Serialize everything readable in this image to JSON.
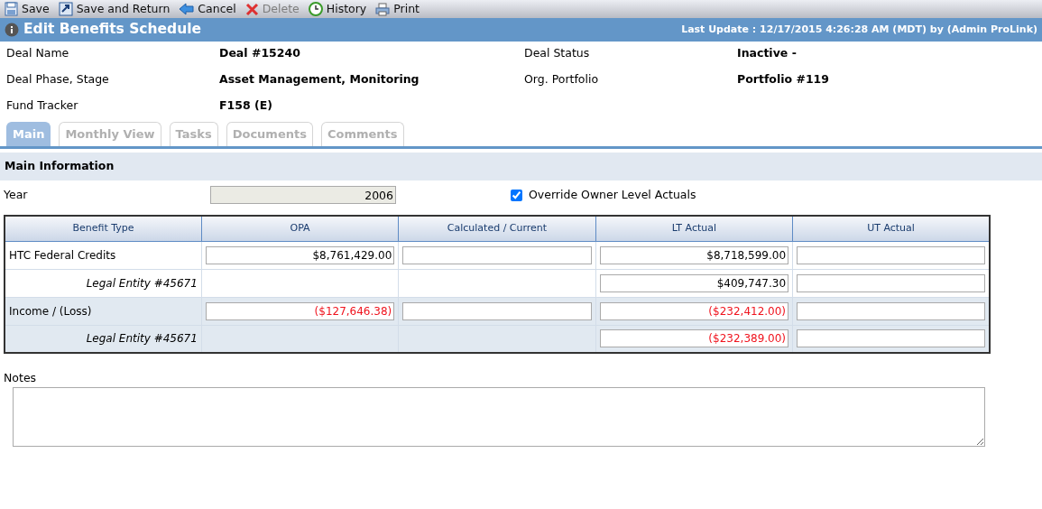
{
  "toolbar": [
    {
      "kind": "save",
      "label": "Save",
      "disabled": false
    },
    {
      "kind": "return",
      "label": "Save and Return",
      "disabled": false
    },
    {
      "kind": "cancel",
      "label": "Cancel",
      "disabled": false
    },
    {
      "kind": "delete",
      "label": "Delete",
      "disabled": true
    },
    {
      "kind": "history",
      "label": "History",
      "disabled": false
    },
    {
      "kind": "print",
      "label": "Print",
      "disabled": false
    }
  ],
  "header": {
    "title": "Edit Benefits Schedule",
    "last_update": "Last Update : 12/17/2015 4:26:28 AM (MDT) by (Admin ProLink)"
  },
  "info": [
    {
      "label": "Deal Name",
      "value": "Deal #15240"
    },
    {
      "label": "Deal Status",
      "value": "Inactive -"
    },
    {
      "label": "Deal Phase, Stage",
      "value": "Asset Management, Monitoring"
    },
    {
      "label": "Org. Portfolio",
      "value": "Portfolio #119"
    },
    {
      "label": "Fund Tracker",
      "value": "F158 (E)"
    }
  ],
  "tabs": [
    {
      "label": "Main",
      "selected": true
    },
    {
      "label": "Monthly View",
      "selected": false
    },
    {
      "label": "Tasks",
      "selected": false
    },
    {
      "label": "Documents",
      "selected": false
    },
    {
      "label": "Comments",
      "selected": false
    }
  ],
  "section_title": "Main Information",
  "year": {
    "label": "Year",
    "value": "2006"
  },
  "override": {
    "label": "Override Owner Level Actuals",
    "checked": true
  },
  "table": {
    "columns": [
      "Benefit Type",
      "OPA",
      "Calculated / Current",
      "LT Actual",
      "UT Actual"
    ],
    "rows": [
      {
        "kind": "main",
        "name": "HTC Federal Credits",
        "shaded": false,
        "cells": [
          {
            "kind": "input",
            "value": "$8,761,429.00",
            "negative": false
          },
          {
            "kind": "input"
          },
          {
            "kind": "input",
            "value": "$8,718,599.00",
            "negative": false
          },
          {
            "kind": "input"
          }
        ]
      },
      {
        "kind": "entity",
        "name": "Legal Entity #45671",
        "shaded": false,
        "cells": [
          {
            "kind": "none"
          },
          {
            "kind": "none"
          },
          {
            "kind": "input",
            "value": "$409,747.30",
            "negative": false
          },
          {
            "kind": "input"
          }
        ]
      },
      {
        "kind": "main",
        "name": "Income / (Loss)",
        "shaded": true,
        "cells": [
          {
            "kind": "input",
            "value": "($127,646.38)",
            "negative": true
          },
          {
            "kind": "input"
          },
          {
            "kind": "input",
            "value": "($232,412.00)",
            "negative": true
          },
          {
            "kind": "input"
          }
        ]
      },
      {
        "kind": "entity",
        "name": "Legal Entity #45671",
        "shaded": true,
        "cells": [
          {
            "kind": "none"
          },
          {
            "kind": "none"
          },
          {
            "kind": "input",
            "value": "($232,389.00)",
            "negative": true
          },
          {
            "kind": "input"
          }
        ]
      }
    ]
  },
  "notes": {
    "label": "Notes"
  }
}
